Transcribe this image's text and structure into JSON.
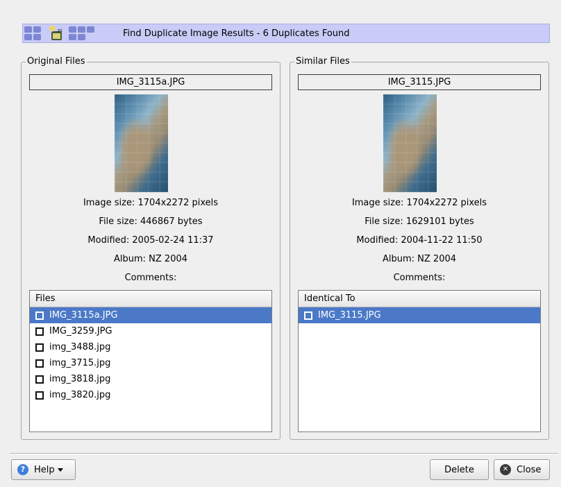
{
  "header": {
    "title": "Find Duplicate Image Results - 6 Duplicates Found",
    "icon": "kipi-plugin-icon"
  },
  "original": {
    "group_title": "Original Files",
    "filename": "IMG_3115a.JPG",
    "image_size": "Image size: 1704x2272 pixels",
    "file_size": "File size: 446867 bytes",
    "modified": "Modified: 2005-02-24 11:37",
    "album": "Album: NZ 2004",
    "comments": "Comments:",
    "list_header": "Files",
    "items": [
      {
        "label": "IMG_3115a.JPG",
        "selected": true
      },
      {
        "label": "IMG_3259.JPG",
        "selected": false
      },
      {
        "label": "img_3488.jpg",
        "selected": false
      },
      {
        "label": "img_3715.jpg",
        "selected": false
      },
      {
        "label": "img_3818.jpg",
        "selected": false
      },
      {
        "label": "img_3820.jpg",
        "selected": false
      }
    ]
  },
  "similar": {
    "group_title": "Similar Files",
    "filename": "IMG_3115.JPG",
    "image_size": "Image size: 1704x2272 pixels",
    "file_size": "File size: 1629101 bytes",
    "modified": "Modified: 2004-11-22 11:50",
    "album": "Album: NZ 2004",
    "comments": "Comments:",
    "list_header": "Identical To",
    "items": [
      {
        "label": "IMG_3115.JPG",
        "selected": true
      }
    ]
  },
  "buttons": {
    "help_label": "Help",
    "delete_label": "Delete",
    "close_label": "Close"
  },
  "colors": {
    "header_bg": "#c9ccf6",
    "selection": "#4b79c7"
  }
}
